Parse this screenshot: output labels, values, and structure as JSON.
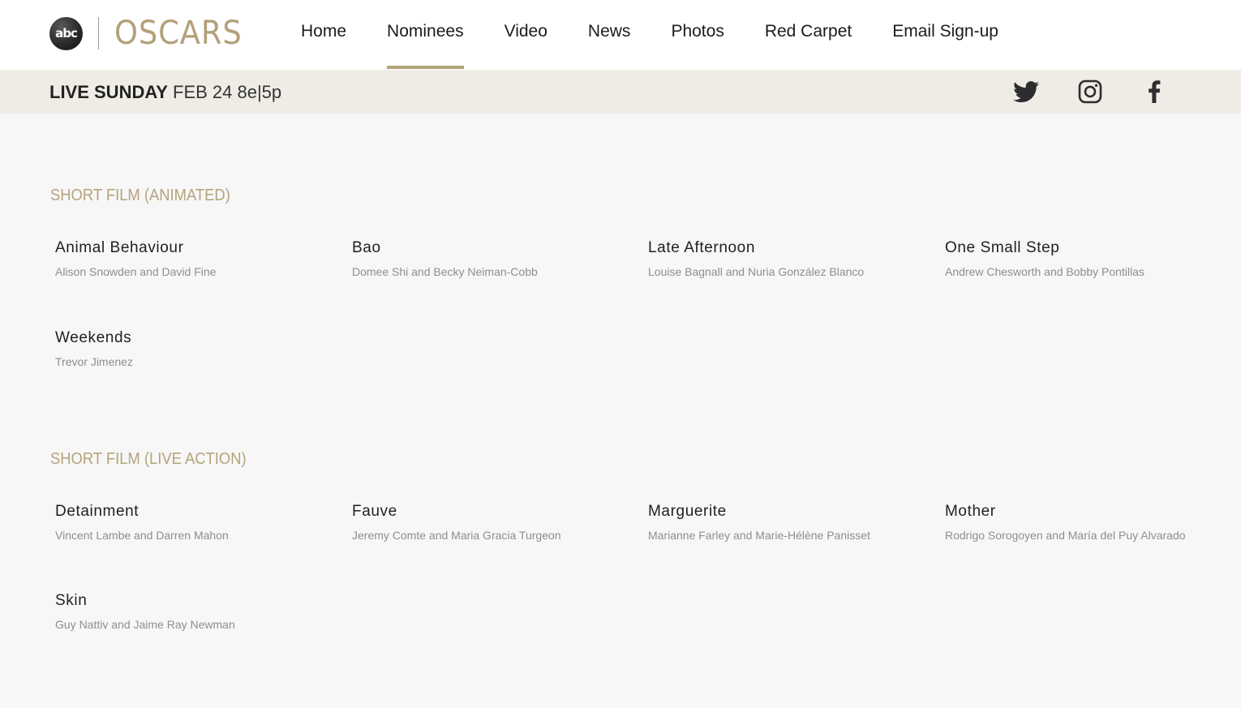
{
  "header": {
    "logo": {
      "abc_text": "abc",
      "oscars_text": "OSCARS"
    },
    "nav": [
      {
        "label": "Home",
        "active": false
      },
      {
        "label": "Nominees",
        "active": true
      },
      {
        "label": "Video",
        "active": false
      },
      {
        "label": "News",
        "active": false
      },
      {
        "label": "Photos",
        "active": false
      },
      {
        "label": "Red Carpet",
        "active": false
      },
      {
        "label": "Email Sign-up",
        "active": false
      }
    ],
    "accent_color": "#b3a47a"
  },
  "subbar": {
    "live_label": "LIVE SUNDAY",
    "air_time": "FEB 24 8e|5p",
    "social": [
      "twitter-icon",
      "instagram-icon",
      "facebook-icon"
    ]
  },
  "sections": [
    {
      "title": "SHORT FILM (ANIMATED)",
      "nominees": [
        {
          "film": "Animal Behaviour",
          "people": "Alison Snowden and David Fine"
        },
        {
          "film": "Bao",
          "people": "Domee Shi and Becky Neiman-Cobb"
        },
        {
          "film": "Late Afternoon",
          "people": "Louise Bagnall and Nuria González Blanco"
        },
        {
          "film": "One Small Step",
          "people": "Andrew Chesworth and Bobby Pontillas"
        },
        {
          "film": "Weekends",
          "people": "Trevor Jimenez"
        }
      ]
    },
    {
      "title": "SHORT FILM (LIVE ACTION)",
      "nominees": [
        {
          "film": "Detainment",
          "people": "Vincent Lambe and Darren Mahon"
        },
        {
          "film": "Fauve",
          "people": "Jeremy Comte and Maria Gracia Turgeon"
        },
        {
          "film": "Marguerite",
          "people": "Marianne Farley and Marie-Hélène Panisset"
        },
        {
          "film": "Mother",
          "people": "Rodrigo Sorogoyen and María del Puy Alvarado"
        },
        {
          "film": "Skin",
          "people": "Guy Nattiv and Jaime Ray Newman"
        }
      ]
    }
  ]
}
